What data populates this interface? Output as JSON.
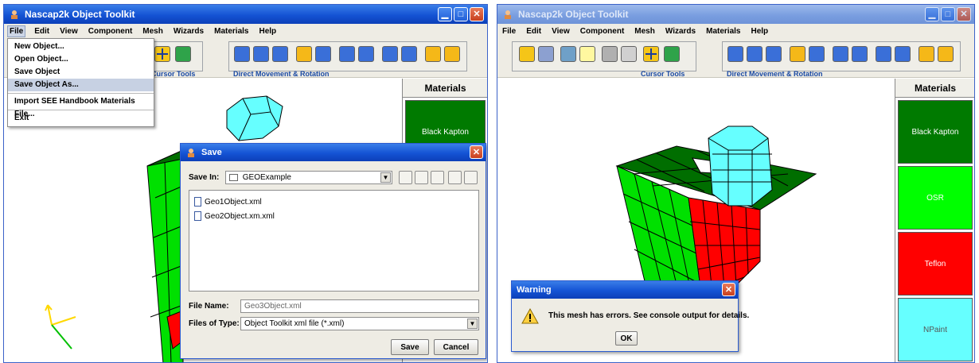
{
  "left_window": {
    "title": "Nascap2k Object Toolkit",
    "menus": [
      "File",
      "Edit",
      "View",
      "Component",
      "Mesh",
      "Wizards",
      "Materials",
      "Help"
    ],
    "file_menu": {
      "items": [
        "New Object...",
        "Open Object...",
        "Save Object",
        "Save Object As...",
        "Import SEE Handbook Materials File...",
        "Exit"
      ],
      "selected": "Save Object As..."
    },
    "toolbar": {
      "cursor_tools_label": "Cursor Tools",
      "direct_label": "Direct Movement & Rotation"
    },
    "materials": {
      "header": "Materials",
      "items": [
        {
          "name": "Black Kapton",
          "color": "#007a00"
        }
      ]
    },
    "save_dialog": {
      "title": "Save",
      "save_in_label": "Save In:",
      "save_in_value": "GEOExample",
      "files": [
        "Geo1Object.xml",
        "Geo2Object.xm.xml"
      ],
      "file_name_label": "File Name:",
      "file_name_value": "Geo3Object.xml",
      "files_of_type_label": "Files of Type:",
      "files_of_type_value": "Object Toolkit xml file (*.xml)",
      "save_button": "Save",
      "cancel_button": "Cancel"
    }
  },
  "right_window": {
    "title": "Nascap2k Object Toolkit",
    "menus": [
      "File",
      "Edit",
      "View",
      "Component",
      "Mesh",
      "Wizards",
      "Materials",
      "Help"
    ],
    "toolbar": {
      "cursor_tools_label": "Cursor Tools",
      "direct_label": "Direct Movement & Rotation"
    },
    "materials": {
      "header": "Materials",
      "items": [
        {
          "name": "Black Kapton",
          "color": "#007a00"
        },
        {
          "name": "OSR",
          "color": "#00ff00"
        },
        {
          "name": "Teflon",
          "color": "#ff0000"
        },
        {
          "name": "NPaint",
          "color": "#66ffff"
        }
      ]
    },
    "warning_dialog": {
      "title": "Warning",
      "message": "This mesh has errors.  See console output for details.",
      "ok_button": "OK"
    }
  },
  "colors": {
    "titlebar": "#1453d4",
    "kapton": "#007a00",
    "osr": "#00ff00",
    "teflon": "#ff0000",
    "npaint": "#66ffff"
  }
}
